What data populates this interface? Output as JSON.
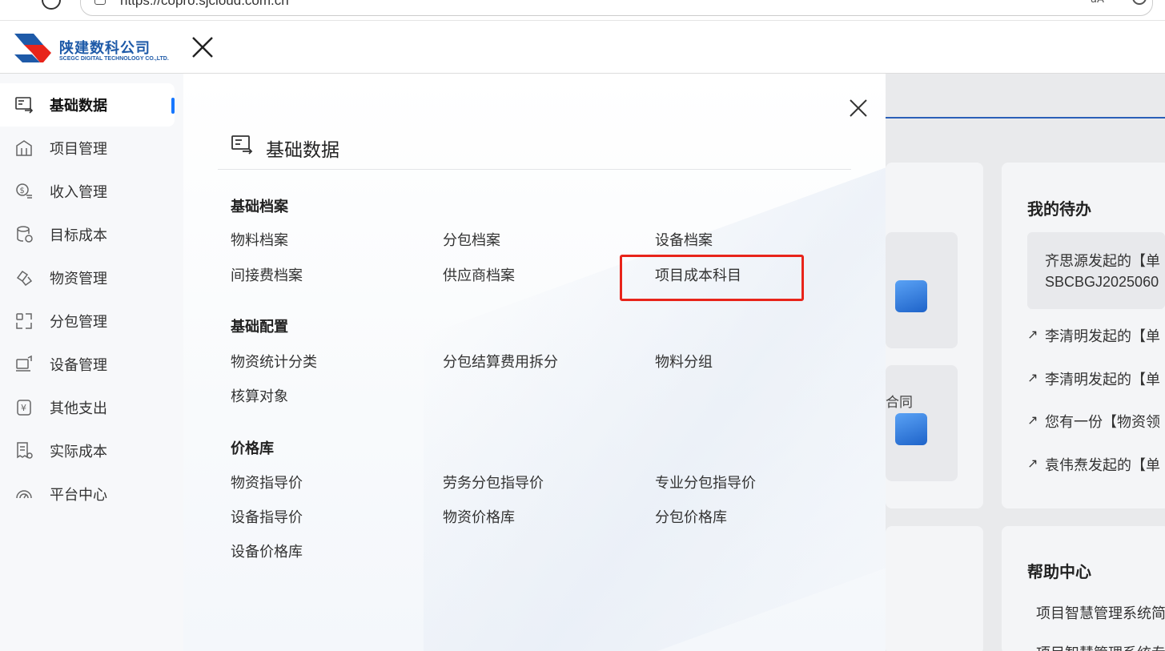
{
  "browser": {
    "url": "https://copro.sjcloud.com.cn",
    "reader_label": "aA"
  },
  "header": {
    "company_cn": "陕建数科公司",
    "company_en": "SCEGC DIGITAL TECHNOLOGY CO.,LTD."
  },
  "sidebar": {
    "items": [
      {
        "label": "基础数据",
        "icon": "data-list-icon"
      },
      {
        "label": "项目管理",
        "icon": "building-icon"
      },
      {
        "label": "收入管理",
        "icon": "money-icon"
      },
      {
        "label": "目标成本",
        "icon": "database-icon"
      },
      {
        "label": "物资管理",
        "icon": "boxes-icon"
      },
      {
        "label": "分包管理",
        "icon": "split-icon"
      },
      {
        "label": "设备管理",
        "icon": "device-icon"
      },
      {
        "label": "其他支出",
        "icon": "yuan-icon"
      },
      {
        "label": "实际成本",
        "icon": "receipt-icon"
      },
      {
        "label": "平台中心",
        "icon": "gauge-icon"
      }
    ]
  },
  "panel": {
    "title": "基础数据",
    "groups": [
      {
        "title": "基础档案",
        "links": [
          "物料档案",
          "分包档案",
          "设备档案",
          "间接费档案",
          "供应商档案",
          "项目成本科目"
        ]
      },
      {
        "title": "基础配置",
        "links": [
          "物资统计分类",
          "分包结算费用拆分",
          "物料分组",
          "核算对象"
        ]
      },
      {
        "title": "价格库",
        "links": [
          "物资指导价",
          "劳务分包指导价",
          "专业分包指导价",
          "设备指导价",
          "物资价格库",
          "分包价格库",
          "设备价格库"
        ]
      }
    ]
  },
  "background": {
    "todo_title": "我的待办",
    "todo_items": [
      "齐思源发起的【单",
      "SBCBGJ2025060",
      "李清明发起的【单",
      "李清明发起的【单",
      "您有一份【物资领",
      "袁伟焘发起的【单"
    ],
    "contract_snippet": "合同",
    "help_title": "帮助中心",
    "help_items": [
      "项目智慧管理系统简",
      "项目智慧管理系统专"
    ]
  },
  "colors": {
    "brand_blue": "#1e5aa8",
    "brand_red": "#e8241a",
    "accent": "#1677ff",
    "highlight": "#e8241a"
  }
}
